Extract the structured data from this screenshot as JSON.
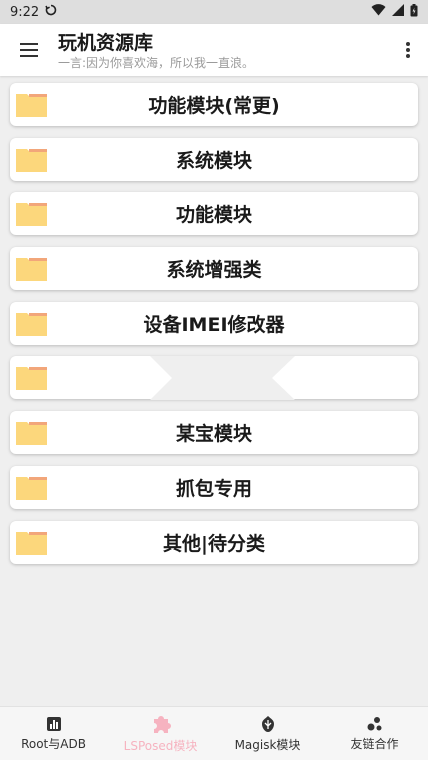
{
  "status_bar": {
    "time": "9:22"
  },
  "app_bar": {
    "title": "玩机资源库",
    "subtitle": "一言:因为你喜欢海，所以我一直浪。"
  },
  "items": [
    {
      "label": "功能模块(常更)"
    },
    {
      "label": "系统模块"
    },
    {
      "label": "功能模块"
    },
    {
      "label": "系统增强类"
    },
    {
      "label": "设备IMEI修改器"
    },
    {
      "label": ""
    },
    {
      "label": "某宝模块"
    },
    {
      "label": "抓包专用"
    },
    {
      "label": "其他|待分类"
    }
  ],
  "bottom_nav": {
    "items": [
      {
        "label": "Root与ADB",
        "icon": "chart-icon"
      },
      {
        "label": "LSPosed模块",
        "icon": "puzzle-icon"
      },
      {
        "label": "Magisk模块",
        "icon": "magisk-icon"
      },
      {
        "label": "友链合作",
        "icon": "bubbles-icon"
      }
    ],
    "active_index": 1
  },
  "colors": {
    "accent_active": "#f6b3c0",
    "folder_body": "#fcd77c",
    "folder_tab": "#f2a67a",
    "background": "#efefef"
  }
}
